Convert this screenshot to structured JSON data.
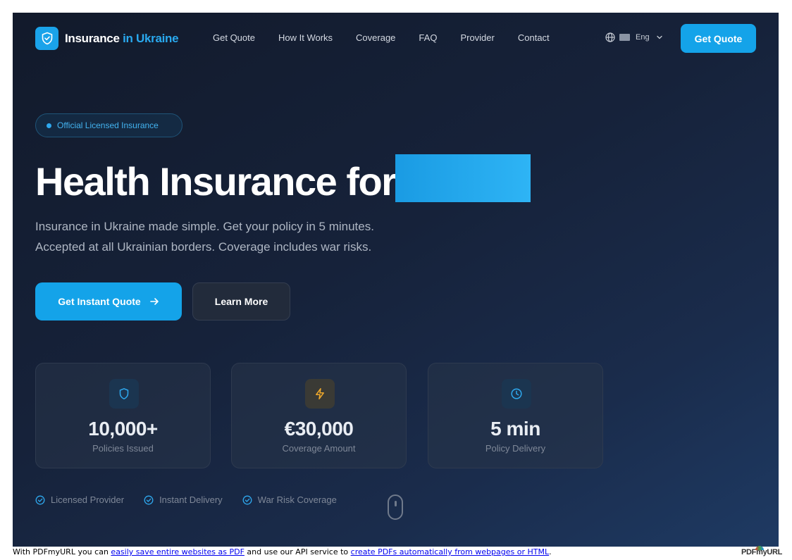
{
  "brand": {
    "name_primary": "Insurance",
    "name_accent": "in Ukraine",
    "accent_color": "#1aa3ea"
  },
  "nav": {
    "links": [
      "Get Quote",
      "How It Works",
      "Coverage",
      "FAQ",
      "Provider",
      "Contact"
    ],
    "language": "Eng",
    "cta_label": "Get Quote"
  },
  "hero": {
    "badge": "Official Licensed Insurance",
    "headline": "Health Insurance for",
    "subtitle_line1": "Insurance in Ukraine made simple. Get your policy in 5 minutes.",
    "subtitle_line2": "Accepted at all Ukrainian borders. Coverage includes war risks.",
    "primary_button": "Get Instant Quote",
    "secondary_button": "Learn More"
  },
  "stats": [
    {
      "value": "10,000+",
      "label": "Policies Issued",
      "icon": "shield-icon"
    },
    {
      "value": "€30,000",
      "label": "Coverage Amount",
      "icon": "lightning-icon"
    },
    {
      "value": "5 min",
      "label": "Policy Delivery",
      "icon": "clock-icon"
    }
  ],
  "features": [
    "Licensed Provider",
    "Instant Delivery",
    "War Risk Coverage"
  ],
  "footer": {
    "prefix": "With PDFmyURL you can",
    "link1": "easily save entire websites as PDF",
    "middle": "and use our API service to",
    "link2": "create PDFs automatically from webpages or HTML",
    "suffix": ".",
    "logo": "PDFmyURL"
  }
}
